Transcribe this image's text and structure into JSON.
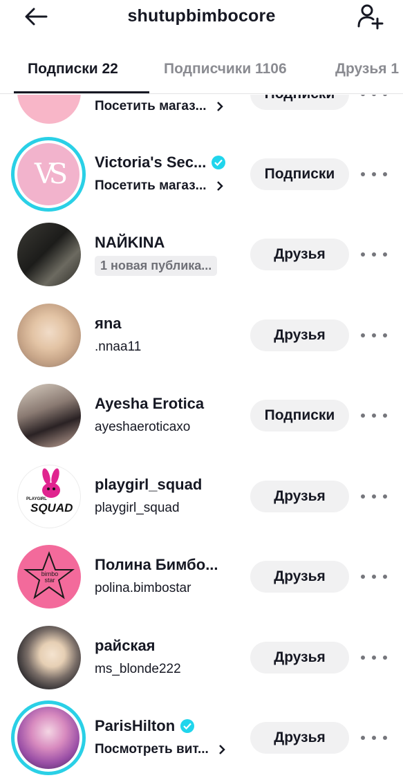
{
  "header": {
    "title": "shutupbimbocore",
    "back_icon": "arrow-left-icon",
    "add_icon": "add-user-icon"
  },
  "tabs": [
    {
      "label": "Подписки 22",
      "active": true
    },
    {
      "label": "Подписчики 1106",
      "active": false
    },
    {
      "label": "Друзья 1",
      "active": false
    }
  ],
  "rows": [
    {
      "name": "",
      "sub": "Посетить магаз...",
      "button": "Подписки",
      "verified": false
    },
    {
      "name": "Victoria's Sec...",
      "sub": "Посетить магаз...",
      "button": "Подписки",
      "verified": true,
      "avatar_text": "VS"
    },
    {
      "name": "NAЙKINA",
      "sub": "1 новая публика...",
      "button": "Друзья",
      "verified": false
    },
    {
      "name": "яna",
      "sub": ".nnaa11",
      "button": "Друзья",
      "verified": false
    },
    {
      "name": "Ayesha Erotica",
      "sub": "ayeshaeroticaxo",
      "button": "Подписки",
      "verified": false
    },
    {
      "name": "playgirl_squad",
      "sub": "playgirl_squad",
      "button": "Друзья",
      "verified": false,
      "avatar_text": "SQUAD",
      "avatar_small_text": "PLAYGIRL"
    },
    {
      "name": "Полина Бимбо...",
      "sub": "polina.bimbostar",
      "button": "Друзья",
      "verified": false,
      "avatar_text": "bimbo star"
    },
    {
      "name": "райская",
      "sub": "ms_blonde222",
      "button": "Друзья",
      "verified": false
    },
    {
      "name": "ParisHilton",
      "sub": "Посмотреть вит...",
      "button": "Друзья",
      "verified": true
    }
  ],
  "colors": {
    "accent_ring": "#2ad0e6",
    "verified": "#20d5ec",
    "button_bg": "#f1f1f2",
    "text": "#161823",
    "muted": "#8a8b91"
  }
}
